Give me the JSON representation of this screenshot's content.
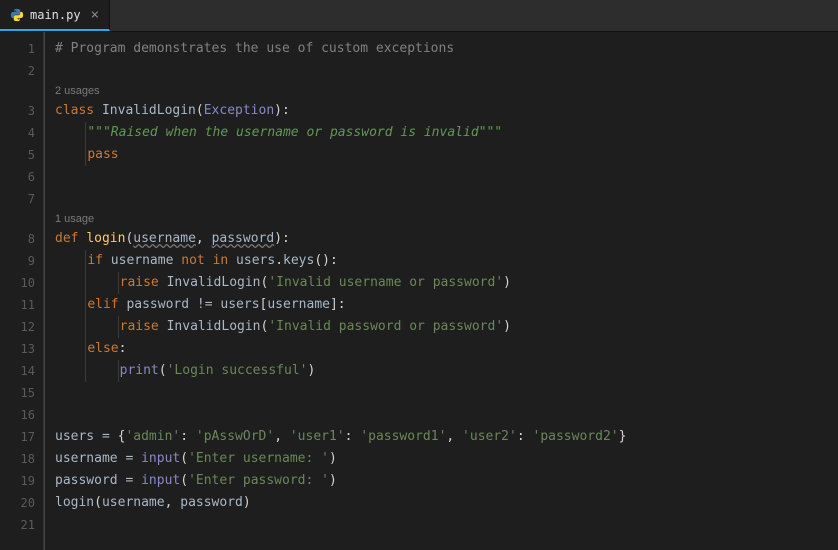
{
  "tab": {
    "filename": "main.py",
    "close_glyph": "×"
  },
  "hints": {
    "class_usages": "2 usages",
    "fn_usages": "1 usage"
  },
  "code": {
    "l1_comment": "# Program demonstrates the use of custom exceptions",
    "l3_class": "class",
    "l3_name": "InvalidLogin",
    "l3_base": "Exception",
    "l4_doc": "\"\"\"Raised when the username or password is invalid\"\"\"",
    "l5_pass": "pass",
    "l8_def": "def",
    "l8_fn": "login",
    "l8_p1": "username",
    "l8_p2": "password",
    "l9_if": "if",
    "l9_ident": "username",
    "l9_not": "not",
    "l9_in": "in",
    "l9_users": "users",
    "l9_keys": "keys",
    "l10_raise": "raise",
    "l10_cls": "InvalidLogin",
    "l10_str": "'Invalid username or password'",
    "l11_elif": "elif",
    "l11_pw": "password",
    "l11_ne": "!=",
    "l11_users": "users",
    "l11_uname": "username",
    "l12_raise": "raise",
    "l12_cls": "InvalidLogin",
    "l12_str": "'Invalid password or password'",
    "l13_else": "else",
    "l14_print": "print",
    "l14_str": "'Login successful'",
    "l17_users": "users",
    "l17_eq": "=",
    "l17_k1": "'admin'",
    "l17_v1": "'pAsswOrD'",
    "l17_k2": "'user1'",
    "l17_v2": "'password1'",
    "l17_k3": "'user2'",
    "l17_v3": "'password2'",
    "l18_uname": "username",
    "l18_eq": "=",
    "l18_input": "input",
    "l18_str": "'Enter username: '",
    "l19_pw": "password",
    "l19_eq": "=",
    "l19_input": "input",
    "l19_str": "'Enter password: '",
    "l20_fn": "login",
    "l20_a1": "username",
    "l20_a2": "password"
  },
  "line_numbers": [
    "1",
    "2",
    "3",
    "4",
    "5",
    "6",
    "7",
    "8",
    "9",
    "10",
    "11",
    "12",
    "13",
    "14",
    "15",
    "16",
    "17",
    "18",
    "19",
    "20",
    "21"
  ]
}
